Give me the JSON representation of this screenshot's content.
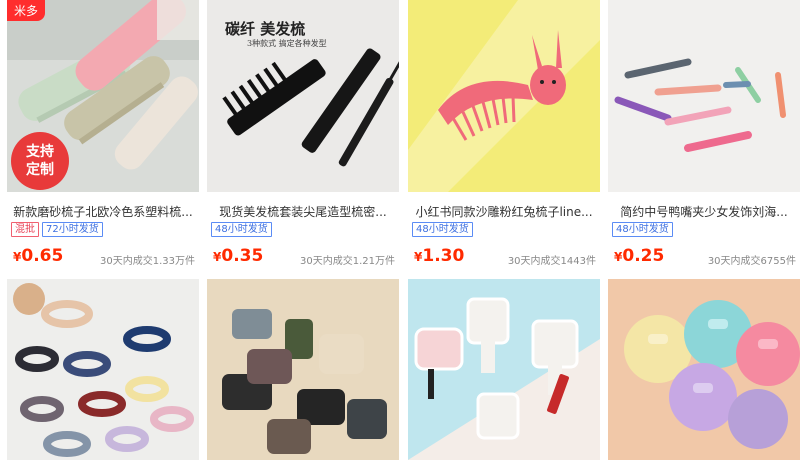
{
  "products": [
    {
      "title": "新款磨砂梳子北欧冷色系塑料梳...",
      "tags": [
        {
          "label": "混批",
          "style": "red"
        },
        {
          "label": "72小时发货",
          "style": "blue"
        }
      ],
      "price": "0.65",
      "sold": "30天内成交1.33万件",
      "image": {
        "badge": "米多",
        "overlay": [
          "支持",
          "定制"
        ],
        "subject": "pastel-combs"
      }
    },
    {
      "title": "现货美发梳套装尖尾造型梳密...",
      "tags": [
        {
          "label": "48小时发货",
          "style": "blue"
        }
      ],
      "price": "0.35",
      "sold": "30天内成交1.21万件",
      "image": {
        "headline": "碳纤 美发梳",
        "subline": "3种款式 搞定各种发型",
        "subject": "black-combs"
      }
    },
    {
      "title": "小红书同款沙雕粉红兔梳子line...",
      "tags": [
        {
          "label": "48小时发货",
          "style": "blue"
        }
      ],
      "price": "1.30",
      "sold": "30天内成交1443件",
      "image": {
        "subject": "pink-rabbit-comb"
      }
    },
    {
      "title": "简约中号鸭嘴夹少女发饰刘海...",
      "tags": [
        {
          "label": "48小时发货",
          "style": "blue"
        }
      ],
      "price": "0.25",
      "sold": "30天内成交6755件",
      "image": {
        "subject": "duckbill-clips"
      }
    },
    {
      "image": {
        "subject": "claw-clips-dark"
      }
    },
    {
      "image": {
        "subject": "claw-clips-matte"
      }
    },
    {
      "image": {
        "subject": "hand-mirrors"
      }
    },
    {
      "image": {
        "subject": "scalp-brushes"
      }
    }
  ],
  "currency": "¥",
  "colors": {
    "price": "#ff2a00",
    "tag_blue": "#3d6fe0",
    "tag_red": "#e84055",
    "badge": "#ff2d2d"
  }
}
